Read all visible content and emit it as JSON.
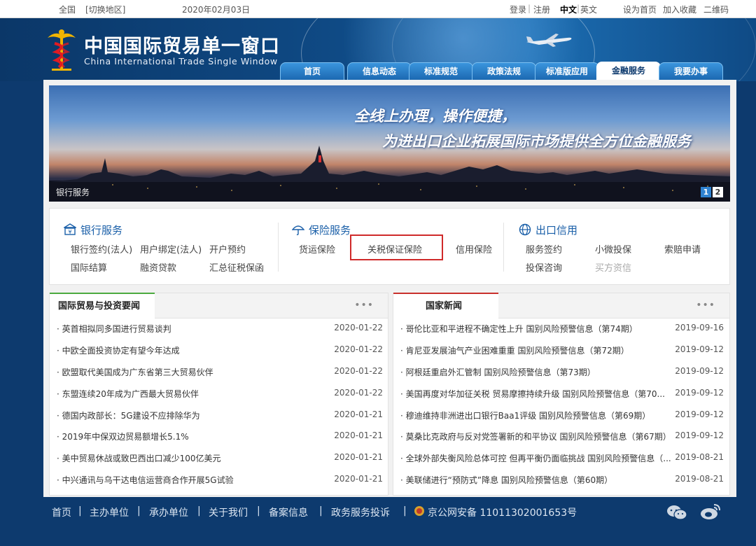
{
  "topbar": {
    "region": "全国",
    "switch_region": "[切换地区]",
    "date": "2020年02月03日",
    "login": "登录",
    "divider": "|",
    "register": "注册",
    "lang_zh": "中文",
    "lang_divider": "|",
    "lang_en": "英文",
    "set_home": "设为首页",
    "add_favorite": "加入收藏",
    "qrcode": "二维码"
  },
  "header": {
    "title_cn": "中国国际贸易单一窗口",
    "title_en": "China International Trade Single  Window",
    "tabs": [
      {
        "label": "首页",
        "active": false
      },
      {
        "label": "信息动态",
        "active": false
      },
      {
        "label": "标准规范",
        "active": false
      },
      {
        "label": "政策法规",
        "active": false
      },
      {
        "label": "标准版应用",
        "active": false
      },
      {
        "label": "金融服务",
        "active": true
      },
      {
        "label": "我要办事",
        "active": false
      }
    ]
  },
  "banner": {
    "line1": "全线上办理，操作便捷，",
    "line2": "为进出口企业拓展国际市场提供全方位金融服务",
    "caption": "银行服务",
    "pages": [
      "1",
      "2"
    ],
    "active_page": 1
  },
  "services": {
    "bank": {
      "title": "银行服务",
      "icon": "bank-icon",
      "items": [
        "银行签约(法人)",
        "用户绑定(法人)",
        "开户预约",
        "国际结算",
        "融资贷款",
        "汇总征税保函"
      ]
    },
    "insurance": {
      "title": "保险服务",
      "icon": "umbrella-icon",
      "items": [
        "货运保险",
        "关税保证保险",
        "信用保险"
      ],
      "highlighted": "关税保证保险"
    },
    "export_credit": {
      "title": "出口信用",
      "icon": "globe-icon",
      "items": [
        "服务签约",
        "小微投保",
        "索赔申请",
        "投保咨询",
        "买方资信"
      ],
      "disabled": [
        "买方资信"
      ]
    }
  },
  "news_left": {
    "title": "国际贸易与投资要闻",
    "more": "•••",
    "items": [
      {
        "title": "· 英首相拟同多国进行贸易谈判",
        "date": "2020-01-22"
      },
      {
        "title": "· 中欧全面投资协定有望今年达成",
        "date": "2020-01-22"
      },
      {
        "title": "· 欧盟取代美国成为广东省第三大贸易伙伴",
        "date": "2020-01-22"
      },
      {
        "title": "· 东盟连续20年成为广西最大贸易伙伴",
        "date": "2020-01-22"
      },
      {
        "title": "· 德国内政部长：5G建设不应排除华为",
        "date": "2020-01-21"
      },
      {
        "title": "· 2019年中保双边贸易额增长5.1%",
        "date": "2020-01-21"
      },
      {
        "title": "· 美中贸易休战或致巴西出口减少100亿美元",
        "date": "2020-01-21"
      },
      {
        "title": "· 中兴通讯与乌干达电信运营商合作开展5G试验",
        "date": "2020-01-21"
      }
    ]
  },
  "news_right": {
    "title": "国家新闻",
    "more": "•••",
    "items": [
      {
        "title": "· 哥伦比亚和平进程不确定性上升 国别风险预警信息（第74期）",
        "date": "2019-09-16"
      },
      {
        "title": "· 肯尼亚发展油气产业困难重重 国别风险预警信息（第72期）",
        "date": "2019-09-12"
      },
      {
        "title": "· 阿根廷重启外汇管制 国别风险预警信息（第73期）",
        "date": "2019-09-12"
      },
      {
        "title": "· 美国再度对华加征关税 贸易摩擦持续升级 国别风险预警信息（第70...",
        "date": "2019-09-12"
      },
      {
        "title": "· 穆迪维持非洲进出口银行Baa1评级 国别风险预警信息（第69期）",
        "date": "2019-09-12"
      },
      {
        "title": "· 莫桑比克政府与反对党签署新的和平协议 国别风险预警信息（第67期）",
        "date": "2019-09-12"
      },
      {
        "title": "· 全球外部失衡风险总体可控 但再平衡仍面临挑战 国别风险预警信息（...",
        "date": "2019-08-21"
      },
      {
        "title": "· 美联储进行“预防式”降息 国别风险预警信息（第60期）",
        "date": "2019-08-21"
      }
    ]
  },
  "footer": {
    "links": [
      "首页",
      "主办单位",
      "承办单位",
      "关于我们",
      "备案信息",
      "政务服务投诉"
    ],
    "divider": "|",
    "icp": "京公网安备 11011302001653号",
    "social": [
      "wechat-icon",
      "weibo-icon"
    ]
  },
  "colors": {
    "page_bg": "#0d3a6e",
    "tab_blue": "#1b67b0",
    "highlight_red": "#cf2a2a",
    "news_accent_green": "#4caa3f",
    "news_accent_red": "#c9302c"
  }
}
